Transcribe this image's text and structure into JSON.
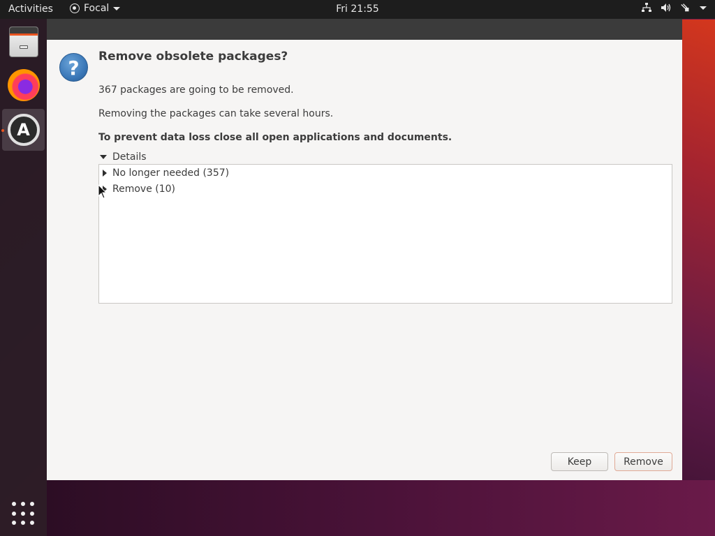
{
  "topbar": {
    "activities": "Activities",
    "app_name": "Focal",
    "clock": "Fri 21:55"
  },
  "dock": {
    "items": [
      {
        "name": "Files",
        "icon": "files-icon"
      },
      {
        "name": "Firefox",
        "icon": "firefox-icon"
      },
      {
        "name": "Software Updater",
        "icon": "software-updater-icon",
        "active": true
      }
    ],
    "show_apps_icon": "grid-icon"
  },
  "dialog": {
    "icon": "question-icon",
    "title": "Remove obsolete packages?",
    "line1": "367 packages are going to be removed.",
    "line2": "Removing the packages can take several hours.",
    "line3": "To prevent data loss close all open applications and documents.",
    "details_label": "Details",
    "tree": [
      {
        "label": "No longer needed (357)"
      },
      {
        "label": "Remove (10)"
      }
    ],
    "buttons": {
      "keep": "Keep",
      "remove": "Remove"
    }
  },
  "colors": {
    "accent": "#e95420",
    "topbar_bg": "#1d1d1d",
    "dialog_bg": "#f6f5f4"
  }
}
